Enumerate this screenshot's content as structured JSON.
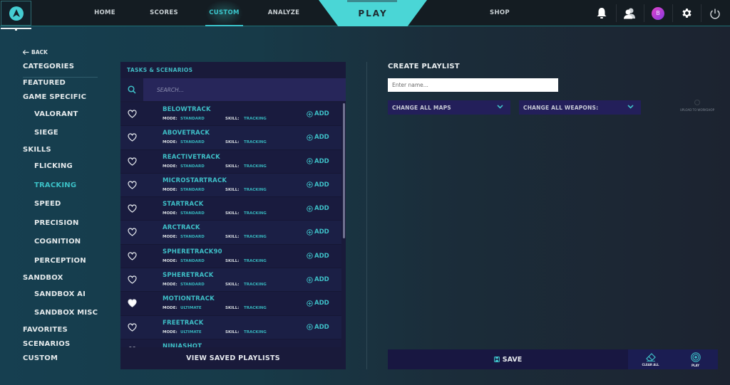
{
  "topnav": {
    "items": [
      {
        "label": "HOME",
        "active": false
      },
      {
        "label": "SCORES",
        "active": false
      },
      {
        "label": "CUSTOM",
        "active": true
      },
      {
        "label": "ANALYZE",
        "active": false
      }
    ],
    "play_label": "PLAY",
    "shop_label": "SHOP",
    "icons": [
      "bell-icon",
      "friends-icon",
      "avatar",
      "gear-icon",
      "power-icon"
    ],
    "avatar_initial": "B",
    "accent_color": "#3bc6cc"
  },
  "sidebar": {
    "back_label": "BACK",
    "title": "CATEGORIES",
    "items": [
      {
        "label": "FEATURED",
        "level": 0
      },
      {
        "label": "GAME SPECIFIC",
        "level": 0
      },
      {
        "label": "VALORANT",
        "level": 1
      },
      {
        "label": "SIEGE",
        "level": 1
      },
      {
        "label": "SKILLS",
        "level": 0
      },
      {
        "label": "FLICKING",
        "level": 1
      },
      {
        "label": "TRACKING",
        "level": 1,
        "active": true
      },
      {
        "label": "SPEED",
        "level": 1
      },
      {
        "label": "PRECISION",
        "level": 1
      },
      {
        "label": "COGNITION",
        "level": 1
      },
      {
        "label": "PERCEPTION",
        "level": 1
      },
      {
        "label": "SANDBOX",
        "level": 0
      },
      {
        "label": "SANDBOX AI",
        "level": 1
      },
      {
        "label": "SANDBOX MISC",
        "level": 1
      },
      {
        "label": "FAVORITES",
        "level": 0
      },
      {
        "label": "SCENARIOS",
        "level": 0
      },
      {
        "label": "CUSTOM",
        "level": 0
      }
    ]
  },
  "tasks": {
    "header": "TASKS & SCENARIOS",
    "search_placeholder": "SEARCH...",
    "mode_label": "MODE:",
    "skill_label": "SKILL:",
    "add_label": "ADD",
    "view_saved_label": "VIEW SAVED PLAYLISTS",
    "rows": [
      {
        "name": "BELOWTRACK",
        "mode": "STANDARD",
        "skill": "TRACKING",
        "favorite": false
      },
      {
        "name": "ABOVETRACK",
        "mode": "STANDARD",
        "skill": "TRACKING",
        "favorite": false
      },
      {
        "name": "REACTIVETRACK",
        "mode": "STANDARD",
        "skill": "TRACKING",
        "favorite": false
      },
      {
        "name": "MICROSTARTRACK",
        "mode": "STANDARD",
        "skill": "TRACKING",
        "favorite": false
      },
      {
        "name": "STARTRACK",
        "mode": "STANDARD",
        "skill": "TRACKING",
        "favorite": false
      },
      {
        "name": "ARCTRACK",
        "mode": "STANDARD",
        "skill": "TRACKING",
        "favorite": false
      },
      {
        "name": "SPHERETRACK90",
        "mode": "STANDARD",
        "skill": "TRACKING",
        "favorite": false
      },
      {
        "name": "SPHERETRACK",
        "mode": "STANDARD",
        "skill": "TRACKING",
        "favorite": false
      },
      {
        "name": "MOTIONTRACK",
        "mode": "ULTIMATE",
        "skill": "TRACKING",
        "favorite": true
      },
      {
        "name": "FREETRACK",
        "mode": "ULTIMATE",
        "skill": "TRACKING",
        "favorite": false
      },
      {
        "name": "NINJASHOT",
        "mode": "",
        "skill": "",
        "favorite": false
      }
    ]
  },
  "playlist": {
    "title": "CREATE PLAYLIST",
    "name_placeholder": "Enter name...",
    "maps_dropdown": "CHANGE ALL MAPS",
    "weapons_dropdown": "CHANGE ALL WEAPONS:",
    "upload_label": "UPLOAD TO WORKSHOP",
    "save_label": "SAVE",
    "clear_all_label": "CLEAR ALL",
    "play_label": "PLAY"
  }
}
